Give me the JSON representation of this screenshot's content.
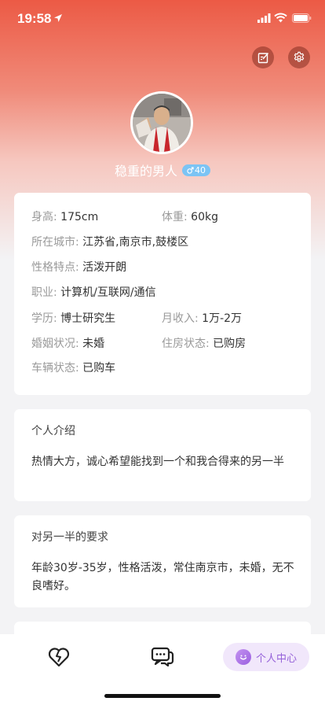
{
  "status_bar": {
    "time": "19:58"
  },
  "profile": {
    "nickname": "稳重的男人",
    "age": "40"
  },
  "info": {
    "height_label": "身高:",
    "height_value": "175cm",
    "weight_label": "体重:",
    "weight_value": "60kg",
    "city_label": "所在城市:",
    "city_value": "江苏省,南京市,鼓楼区",
    "trait_label": "性格特点:",
    "trait_value": "活泼开朗",
    "job_label": "职业:",
    "job_value": "计算机/互联网/通信",
    "edu_label": "学历:",
    "edu_value": "博士研究生",
    "income_label": "月收入:",
    "income_value": "1万-2万",
    "marital_label": "婚姻状况:",
    "marital_value": "未婚",
    "housing_label": "住房状态:",
    "housing_value": "已购房",
    "car_label": "车辆状态:",
    "car_value": "已购车"
  },
  "intro": {
    "title": "个人介绍",
    "text": "热情大方，诚心希望能找到一个和我合得来的另一半"
  },
  "requirements": {
    "title": "对另一半的要求",
    "text": "年龄30岁-35岁，性格活泼，常住南京市，未婚，无不良嗜好。"
  },
  "tabbar": {
    "items": [
      {
        "icon": "heart-icon"
      },
      {
        "icon": "chat-icon"
      },
      {
        "icon": "smile-icon",
        "label": "个人中心",
        "active": true
      }
    ]
  },
  "colors": {
    "header_red": "#ec5a45",
    "badge_blue": "#7cc4f4",
    "active_tab_purple": "#9561d9"
  }
}
